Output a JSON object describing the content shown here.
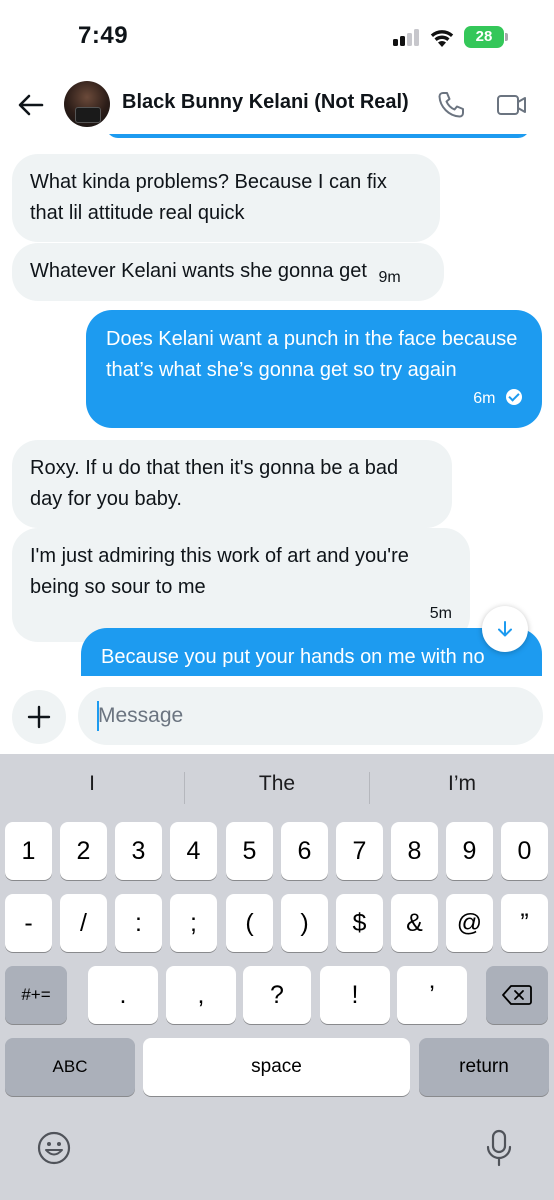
{
  "status_bar": {
    "time": "7:49",
    "battery": "28"
  },
  "header": {
    "title": "Black Bunny Kelani (Not Real)"
  },
  "messages": [
    {
      "direction": "in",
      "text": "What kinda problems? Because I can fix that lil attitude real quick",
      "time": ""
    },
    {
      "direction": "in",
      "text": "Whatever Kelani wants she gonna get",
      "time": "9m"
    },
    {
      "direction": "out",
      "text": "Does Kelani want a punch in the face because that’s what she’s gonna get so try again",
      "time": "6m",
      "status": "read"
    },
    {
      "direction": "in",
      "text": "Roxy. If u do that then it's gonna be a bad day for you baby.",
      "time": ""
    },
    {
      "direction": "in",
      "text": "I'm just admiring this work of art and you're being so sour to me",
      "time": "5m"
    },
    {
      "direction": "out",
      "text": "Because you put your hands on me with no",
      "time": ""
    }
  ],
  "composer": {
    "placeholder": "Message"
  },
  "keyboard": {
    "suggestions": [
      "I",
      "The",
      "I’m"
    ],
    "row1": [
      "1",
      "2",
      "3",
      "4",
      "5",
      "6",
      "7",
      "8",
      "9",
      "0"
    ],
    "row2": [
      "-",
      "/",
      ":",
      ";",
      "(",
      ")",
      "$",
      "&",
      "@",
      "”"
    ],
    "row3": {
      "shift_label": "#+=",
      "keys": [
        ".",
        ",",
        "?",
        "!",
        "’"
      ]
    },
    "row4": {
      "abc": "ABC",
      "space": "space",
      "return": "return"
    }
  },
  "colors": {
    "accent": "#1d9bf0",
    "incoming_bubble": "#eff3f4",
    "battery": "#34c759",
    "keyboard_bg": "#d1d3d9"
  },
  "icons": [
    "back-arrow-icon",
    "phone-icon",
    "video-camera-icon",
    "scroll-down-arrow-icon",
    "plus-icon",
    "backspace-icon",
    "emoji-icon",
    "microphone-icon"
  ]
}
